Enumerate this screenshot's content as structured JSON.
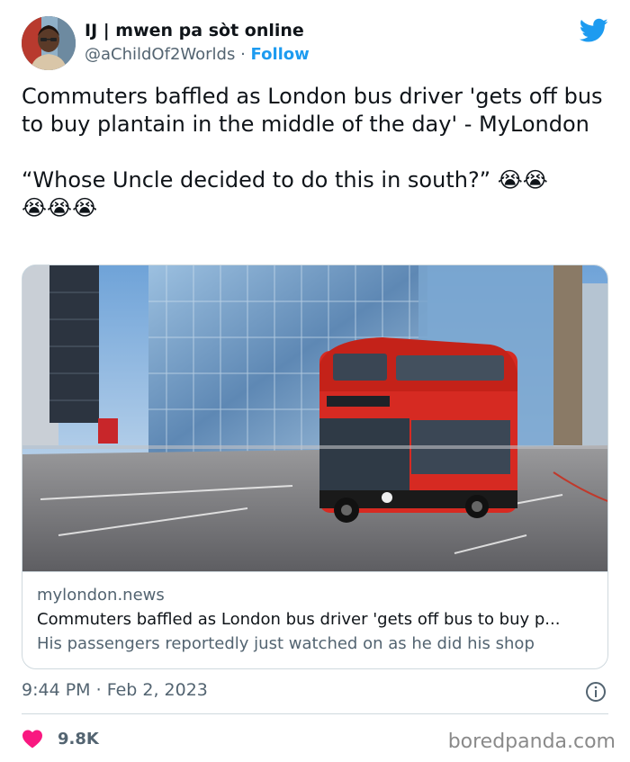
{
  "tweet": {
    "author_name": "IJ | mwen pa sòt online",
    "handle": "@aChildOf2Worlds",
    "separator": " · ",
    "follow_label": "Follow",
    "text_line1": "Commuters baffled as London bus driver 'gets off bus to buy plantain in the middle of the day' - MyLondon",
    "text_line2": "“Whose Uncle decided to do this in south?”",
    "emoji_cry": "😭",
    "time": "9:44 PM",
    "date_separator": " · ",
    "date": "Feb 2, 2023",
    "likes": "9.8K"
  },
  "card": {
    "domain": "mylondon.news",
    "title": "Commuters baffled as London bus driver 'gets off bus to buy p...",
    "description": "His passengers reportedly just watched on as he did his shop"
  },
  "watermark": "boredpanda.com",
  "icons": {
    "logo": "twitter-bird-icon",
    "info": "info-icon",
    "like": "heart-icon"
  },
  "colors": {
    "accent": "#1d9bf0",
    "like": "#f91880",
    "secondary_text": "#536471"
  }
}
